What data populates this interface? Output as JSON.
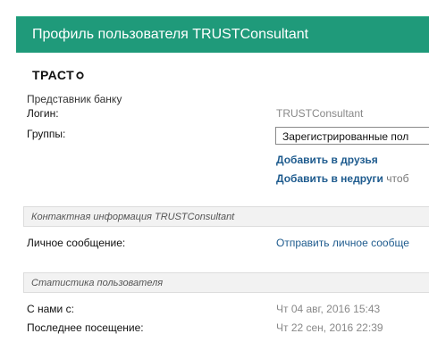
{
  "header": {
    "title": "Профиль пользователя TRUSTConsultant"
  },
  "logo": {
    "text": "ТРАСТ"
  },
  "profile": {
    "rank": "Представник банку",
    "login_label": "Логин:",
    "login_value": "TRUSTConsultant",
    "groups_label": "Группы:",
    "groups_value": "Зарегистрированные пол",
    "add_friend": "Добавить в друзья",
    "add_foe": "Добавить в недруги",
    "add_foe_suffix": "чтоб"
  },
  "contact": {
    "section_title": "Контактная информация TRUSTConsultant",
    "pm_label": "Личное сообщение:",
    "pm_link": "Отправить личное сообще"
  },
  "stats": {
    "section_title": "Статистика пользователя",
    "joined_label": "С нами с:",
    "joined_value": "Чт 04 авг, 2016 15:43",
    "last_visit_label": "Последнее посещение:",
    "last_visit_value": "Чт 22 сен, 2016 22:39"
  },
  "colors": {
    "header_bg": "#1f9a7a",
    "link": "#1e5b8e",
    "muted": "#888888"
  }
}
